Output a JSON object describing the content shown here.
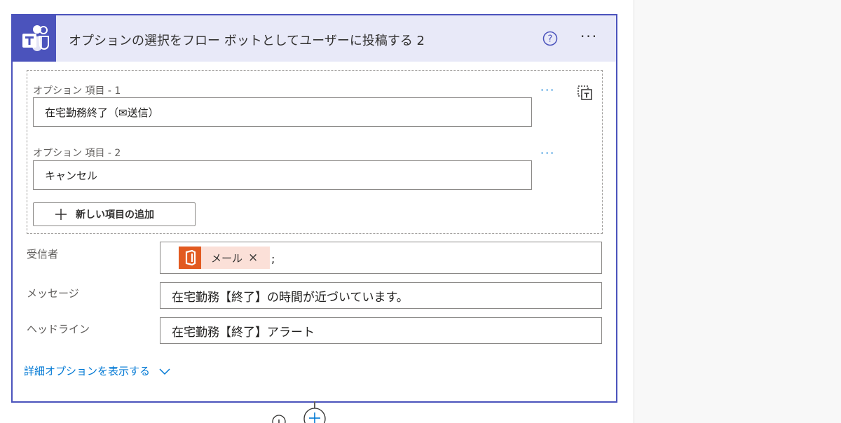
{
  "card": {
    "title": "オプションの選択をフロー ボットとしてユーザーに投稿する 2",
    "app_icon": "teams-icon",
    "accent_color": "#4b53bc",
    "header_color": "#e8e9f8"
  },
  "options": {
    "items": [
      {
        "label": "オプション 項目 - 1",
        "value": "在宅勤務終了（✉送信）"
      },
      {
        "label": "オプション 項目 - 2",
        "value": "キャンセル"
      }
    ],
    "more_label": "···",
    "add_label": "新しい項目の追加"
  },
  "recipient": {
    "label": "受信者",
    "token_label": "メール",
    "token_remove": "×",
    "token_icon": "office365-icon",
    "token_color": "#e25a20",
    "separator": ";"
  },
  "message": {
    "label": "メッセージ",
    "value": "在宅勤務【終了】の時間が近づいています。"
  },
  "headline": {
    "label": "ヘッドライン",
    "value": "在宅勤務【終了】アラート"
  },
  "advanced": {
    "label": "詳細オプションを表示する"
  },
  "header_more": "···"
}
